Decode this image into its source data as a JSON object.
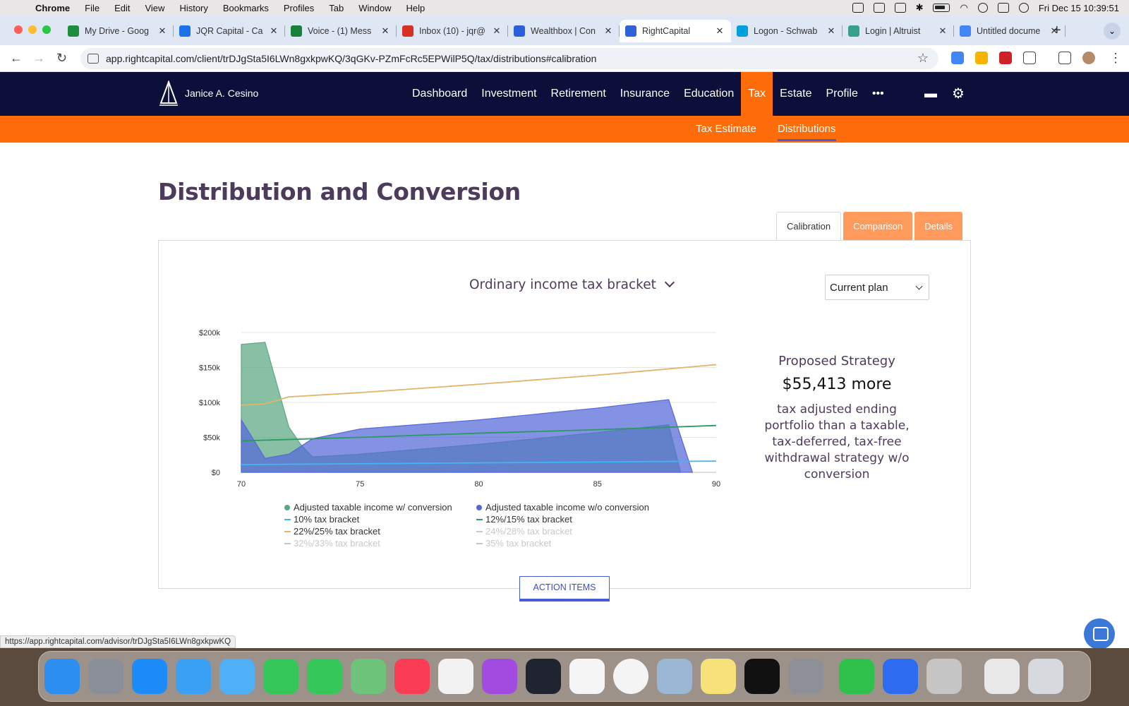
{
  "menubar": {
    "app": "Chrome",
    "items": [
      "File",
      "Edit",
      "View",
      "History",
      "Bookmarks",
      "Profiles",
      "Tab",
      "Window",
      "Help"
    ],
    "datetime": "Fri Dec 15  10:39:51"
  },
  "browser": {
    "tabs": [
      {
        "title": "My Drive - Goog",
        "color": "#1e8e3e"
      },
      {
        "title": "JQR Capital - Ca",
        "color": "#1a73e8"
      },
      {
        "title": "Voice - (1) Mess",
        "color": "#188038"
      },
      {
        "title": "Inbox (10) - jqr@",
        "color": "#d93025"
      },
      {
        "title": "Wealthbox | Con",
        "color": "#2b5fd9"
      },
      {
        "title": "RightCapital",
        "color": "#2f62d6"
      },
      {
        "title": "Logon - Schwab",
        "color": "#00a0df"
      },
      {
        "title": "Login | Altruist",
        "color": "#35a18a"
      },
      {
        "title": "Untitled docume",
        "color": "#4285f4"
      }
    ],
    "url": "app.rightcapital.com/client/trDJgSta5I6LWn8gxkpwKQ/3qGKv-PZmFcRc5EPWilP5Q/tax/distributions#calibration",
    "status_url": "https://app.rightcapital.com/advisor/trDJgSta5I6LWn8gxkpwKQ"
  },
  "app": {
    "client_name": "Janice A. Cesino",
    "nav": [
      "Dashboard",
      "Investment",
      "Retirement",
      "Insurance",
      "Education",
      "Tax",
      "Estate",
      "Profile"
    ],
    "more": "•••",
    "subnav": [
      "Tax Estimate",
      "Distributions"
    ],
    "page_title": "Distribution and Conversion",
    "panel_tabs": [
      "Calibration",
      "Comparison",
      "Details"
    ],
    "chart_selector": "Ordinary income tax bracket",
    "plan_selector": "Current plan",
    "strategy": {
      "title": "Proposed Strategy",
      "amount": "$55,413 more",
      "description": "tax adjusted ending portfolio than a taxable, tax-deferred, tax-free withdrawal strategy w/o conversion"
    },
    "action_button": "ACTION ITEMS"
  },
  "chart_data": {
    "type": "area",
    "x_ticks": [
      "70",
      "75",
      "80",
      "85",
      "90"
    ],
    "y_ticks": [
      "$0",
      "$50k",
      "$100k",
      "$150k",
      "$200k"
    ],
    "xlim": [
      70,
      90
    ],
    "ylim": [
      0,
      200000
    ],
    "grid": true,
    "series": [
      {
        "name": "Adjusted taxable income w/ conversion",
        "kind": "area",
        "color": "#5aa882",
        "x": [
          70,
          71,
          72,
          72.5,
          73,
          75,
          80,
          85,
          88,
          88.5
        ],
        "y": [
          183000,
          186000,
          65000,
          40000,
          22000,
          26000,
          40000,
          57000,
          68000,
          0
        ]
      },
      {
        "name": "Adjusted taxable income w/o conversion",
        "kind": "area",
        "color": "#5568d8",
        "x": [
          70,
          71,
          72,
          73,
          75,
          80,
          85,
          88,
          89
        ],
        "y": [
          75000,
          20000,
          26000,
          48000,
          62000,
          75000,
          92000,
          104000,
          0
        ]
      },
      {
        "name": "10% tax bracket",
        "kind": "line",
        "color": "#3fb6f0",
        "x": [
          70,
          90
        ],
        "y": [
          11000,
          16000
        ]
      },
      {
        "name": "12%/15% tax bracket",
        "kind": "line",
        "color": "#2a9a60",
        "x": [
          70,
          75,
          80,
          85,
          90
        ],
        "y": [
          45000,
          50000,
          56000,
          61000,
          67000
        ]
      },
      {
        "name": "22%/25% tax bracket",
        "kind": "line",
        "color": "#e0b56a",
        "x": [
          70,
          71,
          72,
          75,
          80,
          85,
          90
        ],
        "y": [
          96000,
          98000,
          108000,
          114000,
          126000,
          139000,
          154000
        ]
      },
      {
        "name": "24%/28% tax bracket",
        "kind": "hidden",
        "color": "#c8c8c8"
      },
      {
        "name": "32%/33% tax bracket",
        "kind": "hidden",
        "color": "#c8c8c8"
      },
      {
        "name": "35% tax bracket",
        "kind": "hidden",
        "color": "#c8c8c8"
      }
    ]
  }
}
